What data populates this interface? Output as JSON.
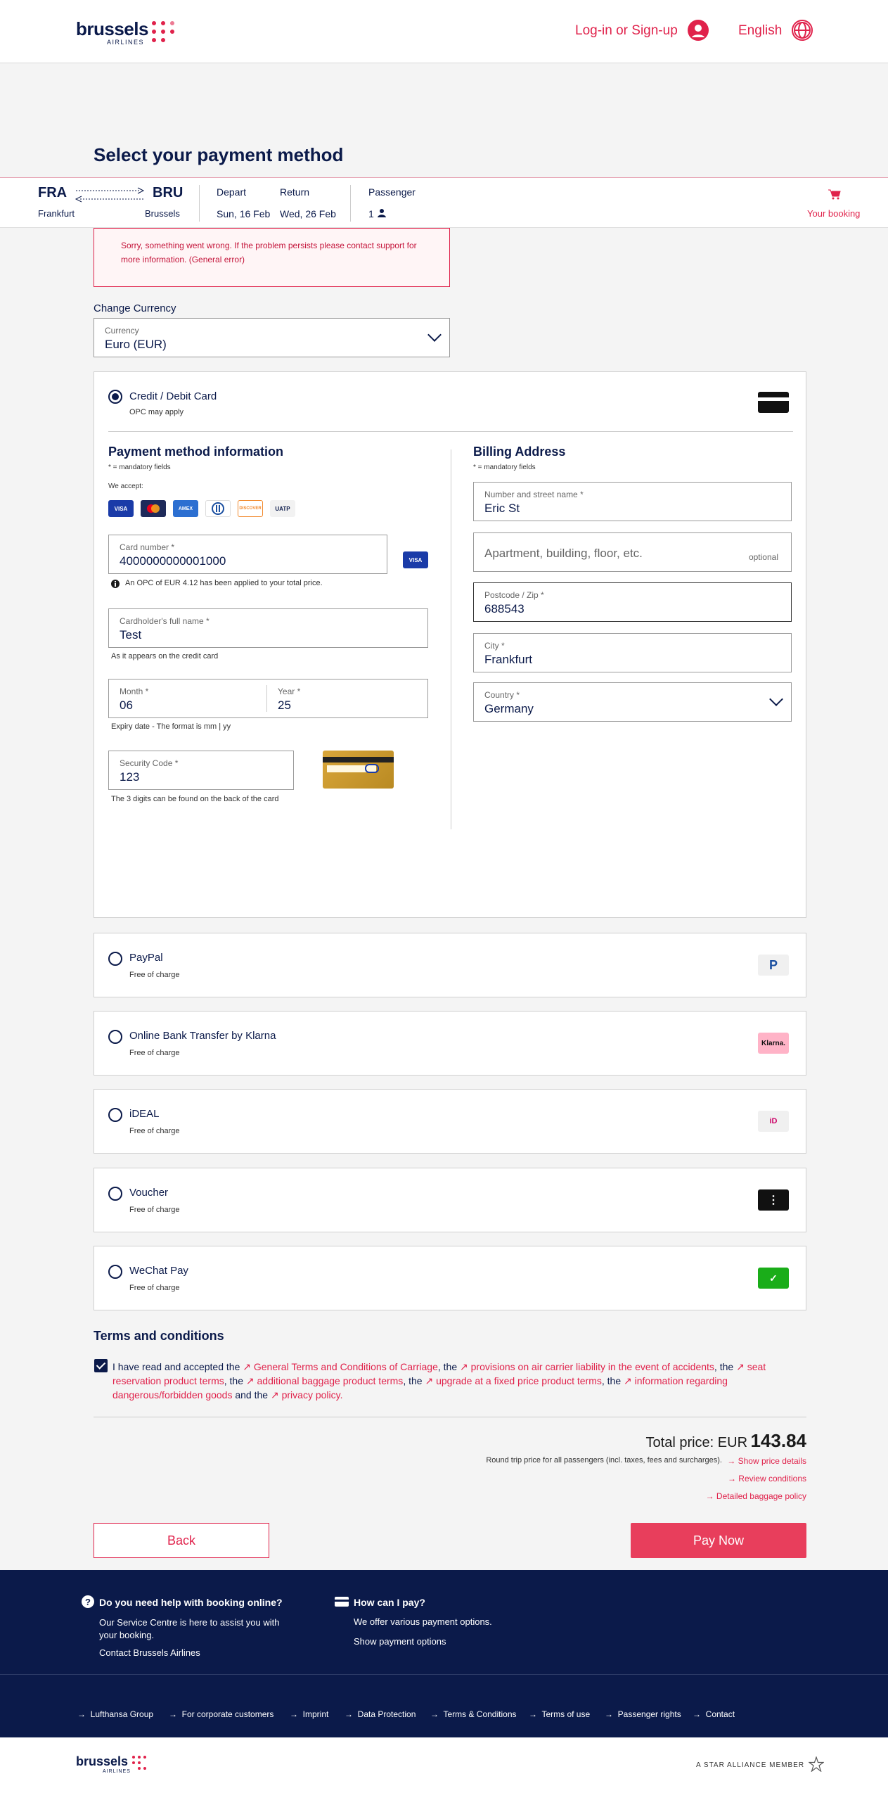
{
  "header": {
    "brand": "brussels",
    "brand_sub": "AIRLINES",
    "login_label": "Log-in or Sign-up",
    "language_label": "English"
  },
  "page_title": "Select your payment method",
  "trip": {
    "from_code": "FRA",
    "from_city": "Frankfurt",
    "to_code": "BRU",
    "to_city": "Brussels",
    "depart_label": "Depart",
    "depart_date": "Sun, 16 Feb",
    "return_label": "Return",
    "return_date": "Wed, 26 Feb",
    "passenger_label": "Passenger",
    "passenger_count": "1",
    "your_booking": "Your booking"
  },
  "error_message": "Sorry, something went wrong. If the problem persists please contact support for more information. (General error)",
  "currency": {
    "heading": "Change Currency",
    "label": "Currency",
    "value": "Euro (EUR)"
  },
  "card_method": {
    "name": "Credit / Debit Card",
    "sub": "OPC may apply",
    "info_title": "Payment method information",
    "mandatory": "* = mandatory fields",
    "we_accept": "We accept:",
    "accepted": [
      "VISA",
      "MC",
      "AMEX",
      "DINERS",
      "DISCOVER",
      "UATP"
    ],
    "card_number_label": "Card number *",
    "card_number_value": "4000000000001000",
    "visa_badge": "VISA",
    "opc_note": "An OPC of EUR 4.12 has been applied to your total price.",
    "holder_label": "Cardholder's full name *",
    "holder_value": "Test",
    "holder_note": "As it appears on the credit card",
    "month_label": "Month *",
    "month_value": "06",
    "year_label": "Year *",
    "year_value": "25",
    "expiry_note": "Expiry date - The format is mm | yy",
    "cvc_label": "Security Code *",
    "cvc_value": "123",
    "cvc_note": "The 3 digits can be found on the back of the card"
  },
  "billing": {
    "title": "Billing Address",
    "mandatory": "* = mandatory fields",
    "street_label": "Number and street name *",
    "street_value": "Eric St",
    "apt_placeholder": "Apartment, building, floor, etc.",
    "apt_optional": "optional",
    "zip_label": "Postcode / Zip *",
    "zip_value": "688543",
    "city_label": "City *",
    "city_value": "Frankfurt",
    "country_label": "Country *",
    "country_value": "Germany"
  },
  "other_methods": [
    {
      "name": "PayPal",
      "sub": "Free of charge",
      "logo": "P"
    },
    {
      "name": "Online Bank Transfer by Klarna",
      "sub": "Free of charge",
      "logo": "Klarna."
    },
    {
      "name": "iDEAL",
      "sub": "Free of charge",
      "logo": "iD"
    },
    {
      "name": "Voucher",
      "sub": "Free of charge",
      "logo": "⋮"
    },
    {
      "name": "WeChat Pay",
      "sub": "Free of charge",
      "logo": "✓"
    }
  ],
  "terms": {
    "title": "Terms and conditions",
    "t1": "I have read and accepted the ",
    "l1": "General Terms and Conditions of Carriage",
    "t2": ", the ",
    "l2": "provisions on air carrier liability in the event of accidents",
    "t3": ", the ",
    "l3": "seat reservation product terms",
    "t4": ", the ",
    "l4": "additional baggage product terms",
    "t5": ", the ",
    "l5": "upgrade at a fixed price product terms",
    "t6": ", the ",
    "l6": "information regarding dangerous/forbidden goods",
    "t7": " and the ",
    "l7": "privacy policy."
  },
  "price": {
    "label": "Total price: EUR",
    "amount": "143.84",
    "note": "Round trip price for all passengers (incl. taxes, fees and surcharges).",
    "show_details": "Show price details",
    "review": "Review conditions",
    "baggage": "Detailed baggage policy"
  },
  "buttons": {
    "back": "Back",
    "pay": "Pay Now"
  },
  "footer": {
    "help_title": "Do you need help with booking online?",
    "help_text": "Our Service Centre is here to assist you with your booking.",
    "help_link": "Contact Brussels Airlines",
    "pay_title": "How can I pay?",
    "pay_text": "We offer various payment options.",
    "pay_link": "Show payment options",
    "links": [
      "Lufthansa Group",
      "For corporate customers",
      "Imprint",
      "Data Protection",
      "Terms & Conditions",
      "Terms of use",
      "Passenger rights",
      "Contact"
    ],
    "star_alliance": "A STAR ALLIANCE MEMBER"
  },
  "colors": {
    "brand_red": "#e0224b",
    "navy": "#0b1a4a",
    "pay_button": "#e83e5c"
  }
}
